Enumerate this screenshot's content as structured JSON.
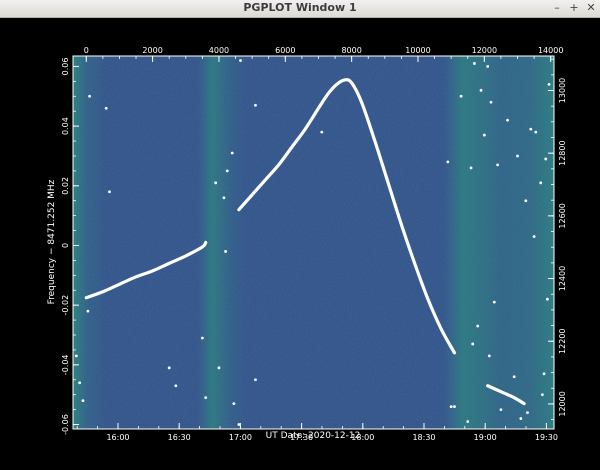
{
  "window": {
    "title": "PGPLOT Window 1",
    "buttons": {
      "minimize": "–",
      "maximize": "+",
      "close": "✕"
    }
  },
  "colors": {
    "background": "#000000",
    "axes": "#ffffff",
    "trace": "#ffffff",
    "map_base": "#2f4f86",
    "map_band": "#2aa379"
  },
  "chart_data": {
    "type": "scatter",
    "title": "",
    "xlabel": "UT Date: 2020-12-12",
    "ylabel": "Frequency − 8471.252 MHz",
    "x_bottom_ticks": [
      "16:00",
      "16:30",
      "17:00",
      "17:30",
      "18:00",
      "18:30",
      "19:00",
      "19:30"
    ],
    "x_top_ticks": [
      "0",
      "2000",
      "4000",
      "6000",
      "8000",
      "10000",
      "12000",
      "14000"
    ],
    "y_left_ticks": [
      "-0.06",
      "-0.04",
      "-0.02",
      "0",
      "0.02",
      "0.04",
      "0.06"
    ],
    "y_right_ticks": [
      "12000",
      "12200",
      "12400",
      "12600",
      "12800",
      "13000"
    ],
    "xlim_top": [
      -400,
      14100
    ],
    "ylim": [
      -0.0615,
      0.0635
    ],
    "ylim_right": [
      11920,
      13110
    ],
    "grid": false,
    "background": "spectrogram noise with bright vertical bands",
    "bright_bands_x_top": [
      0,
      3700,
      4400,
      11400,
      12000,
      13800
    ],
    "series": [
      {
        "x_top": [
          0,
          500,
          1000,
          1500,
          2000,
          2500,
          3000,
          3500,
          3600
        ],
        "y": [
          -0.0175,
          -0.0155,
          -0.013,
          -0.0105,
          -0.0085,
          -0.006,
          -0.0035,
          -0.0005,
          0.001
        ]
      },
      {
        "x_top": [
          4600,
          5000,
          5400,
          5800,
          6200,
          6600,
          7000,
          7300,
          7550,
          7800,
          8000,
          8300,
          8700,
          9100,
          9500,
          9900,
          10300,
          10700,
          11100
        ],
        "y": [
          0.012,
          0.017,
          0.022,
          0.027,
          0.033,
          0.039,
          0.046,
          0.051,
          0.054,
          0.0555,
          0.0545,
          0.048,
          0.035,
          0.021,
          0.007,
          -0.006,
          -0.018,
          -0.028,
          -0.036
        ]
      },
      {
        "x_top": [
          12100,
          12500,
          12900,
          13200
        ],
        "y": [
          -0.047,
          -0.049,
          -0.051,
          -0.053
        ]
      }
    ],
    "outlier_points": [
      {
        "x": 100,
        "y": 0.05
      },
      {
        "x": 600,
        "y": 0.046
      },
      {
        "x": 700,
        "y": 0.018
      },
      {
        "x": -300,
        "y": -0.037
      },
      {
        "x": -200,
        "y": -0.046
      },
      {
        "x": 50,
        "y": -0.022
      },
      {
        "x": -100,
        "y": -0.052
      },
      {
        "x": 2500,
        "y": -0.041
      },
      {
        "x": 2700,
        "y": -0.047
      },
      {
        "x": 3500,
        "y": -0.031
      },
      {
        "x": 3600,
        "y": -0.051
      },
      {
        "x": 3900,
        "y": 0.021
      },
      {
        "x": 4000,
        "y": -0.041
      },
      {
        "x": 4150,
        "y": 0.016
      },
      {
        "x": 4200,
        "y": -0.002
      },
      {
        "x": 4250,
        "y": 0.025
      },
      {
        "x": 4400,
        "y": 0.031
      },
      {
        "x": 4450,
        "y": -0.053
      },
      {
        "x": 4600,
        "y": -0.06
      },
      {
        "x": 4650,
        "y": 0.062
      },
      {
        "x": 5100,
        "y": 0.047
      },
      {
        "x": 5100,
        "y": -0.045
      },
      {
        "x": 7100,
        "y": 0.038
      },
      {
        "x": 10900,
        "y": 0.028
      },
      {
        "x": 11000,
        "y": -0.054
      },
      {
        "x": 11100,
        "y": -0.054
      },
      {
        "x": 11300,
        "y": 0.05
      },
      {
        "x": 11500,
        "y": -0.059
      },
      {
        "x": 11600,
        "y": 0.026
      },
      {
        "x": 11650,
        "y": -0.033
      },
      {
        "x": 11700,
        "y": 0.061
      },
      {
        "x": 11800,
        "y": -0.027
      },
      {
        "x": 11900,
        "y": 0.052
      },
      {
        "x": 12000,
        "y": 0.037
      },
      {
        "x": 12100,
        "y": 0.06
      },
      {
        "x": 12150,
        "y": -0.037
      },
      {
        "x": 12200,
        "y": 0.048
      },
      {
        "x": 12300,
        "y": -0.019
      },
      {
        "x": 12400,
        "y": 0.027
      },
      {
        "x": 12500,
        "y": -0.055
      },
      {
        "x": 12700,
        "y": 0.042
      },
      {
        "x": 12900,
        "y": -0.044
      },
      {
        "x": 13000,
        "y": 0.03
      },
      {
        "x": 13100,
        "y": -0.058
      },
      {
        "x": 13250,
        "y": 0.015
      },
      {
        "x": 13300,
        "y": -0.056
      },
      {
        "x": 13400,
        "y": 0.039
      },
      {
        "x": 13500,
        "y": 0.003
      },
      {
        "x": 13550,
        "y": 0.038
      },
      {
        "x": 13700,
        "y": 0.021
      },
      {
        "x": 13750,
        "y": -0.05
      },
      {
        "x": 13800,
        "y": -0.043
      },
      {
        "x": 13850,
        "y": 0.029
      },
      {
        "x": 13900,
        "y": -0.018
      },
      {
        "x": 13950,
        "y": 0.054
      }
    ]
  }
}
